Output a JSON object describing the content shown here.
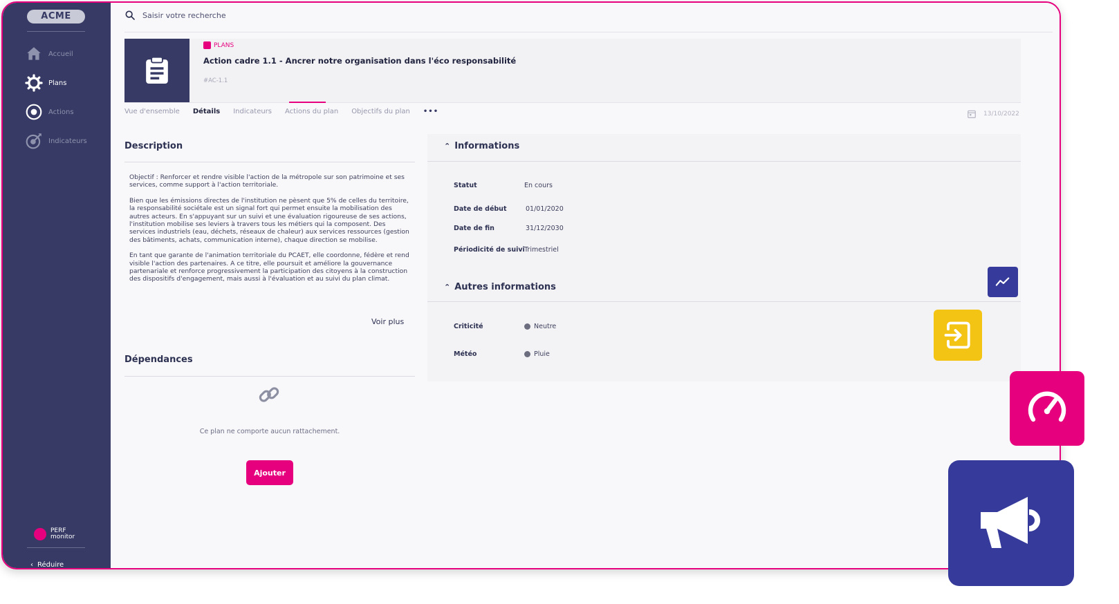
{
  "sidebar": {
    "logo": "ACME",
    "items": [
      {
        "label": "Accueil",
        "icon": "home-icon"
      },
      {
        "label": "Plans",
        "icon": "gear-icon"
      },
      {
        "label": "Actions",
        "icon": "target-icon"
      },
      {
        "label": "Indicateurs",
        "icon": "dart-icon"
      }
    ],
    "brand_line1": "PERF",
    "brand_line2": "monitor",
    "reduce_label": "Réduire"
  },
  "search": {
    "placeholder": "Saisir votre recherche"
  },
  "plan": {
    "tag": "PLANS",
    "title": "Action cadre 1.1 - Ancrer notre organisation dans l'éco responsabilité",
    "ref": "#AC-1.1"
  },
  "tabs": [
    {
      "label": "Vue d'ensemble"
    },
    {
      "label": "Détails",
      "active": true
    },
    {
      "label": "Indicateurs"
    },
    {
      "label": "Actions du plan"
    },
    {
      "label": "Objectifs du plan"
    }
  ],
  "tabs_more": "•••",
  "date": "13/10/2022",
  "description": {
    "title": "Description",
    "paragraphs": [
      "Objectif : Renforcer et rendre visible l'action de la métropole sur son patrimoine et ses services, comme support à l'action territoriale.",
      "Bien que les émissions directes de l'institution ne pèsent que 5% de celles du territoire, la responsabilité sociétale est un signal fort qui permet ensuite la mobilisation des autres acteurs. En s'appuyant sur un suivi et une évaluation rigoureuse de ses actions, l'institution mobilise ses leviers à travers tous les métiers qui la composent. Des services industriels (eau, déchets, réseaux de chaleur) aux services ressources (gestion des bâtiments, achats, communication interne), chaque direction se mobilise.",
      "En tant que garante de l'animation territoriale du PCAET, elle coordonne, fédère et rend visible l'action des partenaires. A ce titre, elle poursuit et améliore la gouvernance partenariale et renforce progressivement la participation des citoyens à la construction des dispositifs d'engagement, mais aussi à l'évaluation et au suivi du plan climat."
    ],
    "more_label": "Voir plus"
  },
  "dependencies": {
    "title": "Dépendances",
    "empty_text": "Ce plan ne comporte aucun rattachement.",
    "add_label": "Ajouter"
  },
  "informations": {
    "title": "Informations",
    "fields": [
      {
        "label": "Statut",
        "value": "En cours"
      },
      {
        "label": "Date de début",
        "value": "01/01/2020"
      },
      {
        "label": "Date de fin",
        "value": "31/12/2030"
      },
      {
        "label": "Périodicité de suivi",
        "value": "Trimestriel"
      }
    ]
  },
  "other_info": {
    "title": "Autres informations",
    "fields": [
      {
        "label": "Criticité",
        "value": "Neutre"
      },
      {
        "label": "Météo",
        "value": "Pluie"
      }
    ]
  },
  "colors": {
    "accent": "#e6007e",
    "sidebar": "#363a64",
    "indigo": "#363a9a",
    "yellow": "#f4c414"
  }
}
